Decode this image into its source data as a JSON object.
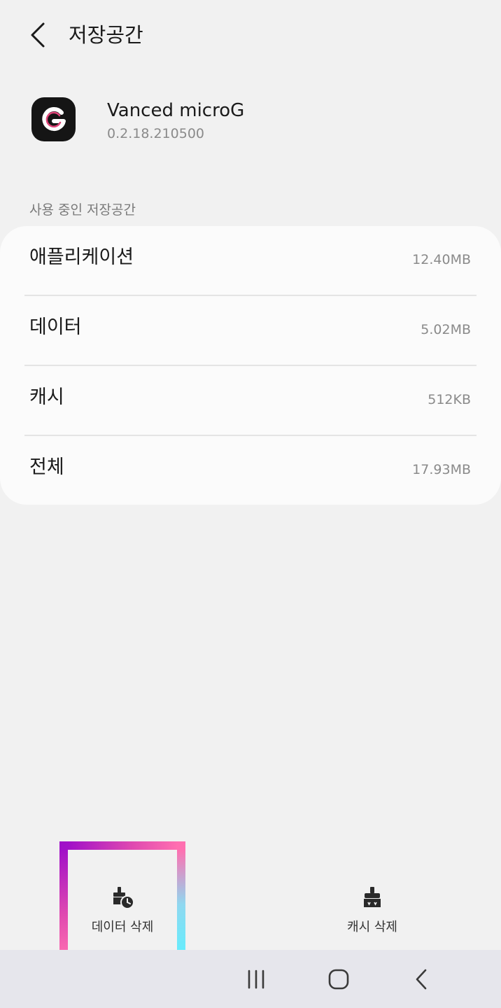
{
  "header": {
    "title": "저장공간"
  },
  "app": {
    "name": "Vanced microG",
    "version": "0.2.18.210500"
  },
  "storage": {
    "section_title": "사용 중인 저장공간",
    "rows": [
      {
        "label": "애플리케이션",
        "value": "12.40MB"
      },
      {
        "label": "데이터",
        "value": "5.02MB"
      },
      {
        "label": "캐시",
        "value": "512KB"
      },
      {
        "label": "전체",
        "value": "17.93MB"
      }
    ]
  },
  "actions": {
    "clear_data_label": "데이터 삭제",
    "clear_cache_label": "캐시 삭제"
  },
  "icons": {
    "back": "chevron-left-icon",
    "app": "vanced-microg-logo",
    "clear_data": "clear-data-icon",
    "clear_cache": "broom-icon",
    "nav_recents": "recents-icon",
    "nav_home": "home-icon",
    "nav_back": "back-icon"
  },
  "colors": {
    "background": "#f1f1f1",
    "card": "#fbfbfb",
    "navbar": "#e6e6ec",
    "highlight_start": "#a010c8",
    "highlight_end": "#5ff0ff"
  }
}
